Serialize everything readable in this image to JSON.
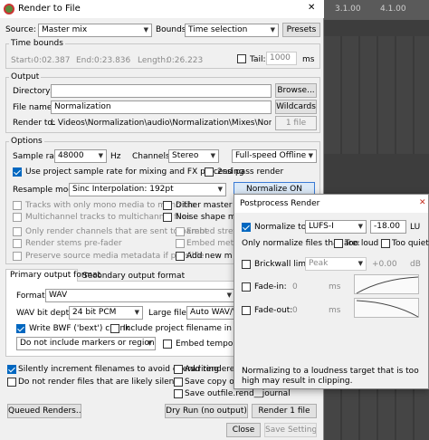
{
  "window": {
    "title": "Render to File",
    "close": "✕"
  },
  "bg_text": {
    "t1": "3.1.00",
    "t2": "4.1.00"
  },
  "source": {
    "label": "Source:",
    "value": "Master mix",
    "bounds_label": "Bounds:",
    "bounds_value": "Time selection",
    "presets": "Presets"
  },
  "time_bounds": {
    "title": "Time bounds",
    "start_label": "Start:",
    "start_value": "-0:02.387",
    "end_label": "End:",
    "end_value": "0:23.836",
    "length_label": "Length:",
    "length_value": "0:26.223",
    "tail_label": "Tail:",
    "tail_value": "1000",
    "tail_unit": "ms"
  },
  "output": {
    "title": "Output",
    "directory_label": "Directory:",
    "directory_value": "",
    "browse": "Browse...",
    "filename_label": "File name:",
    "filename_value": "Normalization",
    "wildcards": "Wildcards",
    "render_to_label": "Render to:",
    "render_to_value": "L Videos\\Normalization\\audio\\Normalization\\Mixes\\Normalization.wav",
    "files_count": "1 file"
  },
  "options": {
    "title": "Options",
    "sample_rate_label": "Sample rate:",
    "sample_rate_value": "48000",
    "hz": "Hz",
    "channels_label": "Channels:",
    "channels_value": "Stereo",
    "speed_value": "Full-speed Offline",
    "use_project_rate": "Use project sample rate for mixing and FX processing",
    "second_pass": "2nd pass render",
    "resample_label": "Resample mode:",
    "resample_value": "Sinc Interpolation: 192pt",
    "normalize_btn": "Normalize ON",
    "mono_tracks": "Tracks with only mono media to mono file",
    "dither_master": "Dither master",
    "multichannel": "Multichannel tracks to multichannel files",
    "noise_shape": "Noise shape master",
    "only_render_parent": "Only render channels that are sent to parent",
    "embed1": "Embed stret",
    "render_prefader": "Render stems pre-fader",
    "embed2": "Embed meta",
    "preserve_metadata": "Preserve source media metadata if possible",
    "add_new": "Add new m"
  },
  "format_tabs": {
    "primary": "Primary output format",
    "secondary": "Secondary output format"
  },
  "format": {
    "format_label": "Format:",
    "format_value": "WAV",
    "bit_depth_label": "WAV bit depth:",
    "bit_depth_value": "24 bit PCM",
    "large_files_label": "Large files:",
    "large_files_value": "Auto WAV/Wa",
    "write_bwf": "Write BWF ('bext') chunk",
    "include_project_filename": "Include project filename in BWF data",
    "markers_value": "Do not include markers or regions",
    "embed_tempo": "Embed tempo"
  },
  "bottom": {
    "silent_increment": "Silently increment filenames to avoid overwriting",
    "add_rendered": "Add rendered ite",
    "no_silent": "Do not render files that are likely silent",
    "save_copy": "Save copy of pro",
    "save_outfile": "Save outfile.rend__journal"
  },
  "buttons": {
    "queued": "Queued Renders...",
    "dry_run": "Dry Run (no output)",
    "render": "Render 1 file",
    "close": "Close",
    "save_settings": "Save Settings"
  },
  "postprocess": {
    "title": "Postprocess Render",
    "close": "✕",
    "normalize_to": "Normalize to:",
    "norm_mode": "LUFS-I",
    "norm_value": "-18.00",
    "norm_unit": "LU",
    "only_normalize": "Only normalize files that are:",
    "too_loud": "Too loud",
    "too_quiet": "Too quiet",
    "brickwall": "Brickwall limit:",
    "brick_mode": "Peak",
    "brick_value": "+0.00",
    "brick_unit": "dB",
    "fadein": "Fade-in:",
    "fadein_value": "0",
    "fadein_unit": "ms",
    "fadeout": "Fade-out:",
    "fadeout_value": "0",
    "fadeout_unit": "ms",
    "note": "Normalizing to a loudness target that is too high may result in clipping."
  },
  "colors": {
    "accent": "#0067c0",
    "panel": "#f0f0f0",
    "daw_bg": "#3a3a3a"
  }
}
